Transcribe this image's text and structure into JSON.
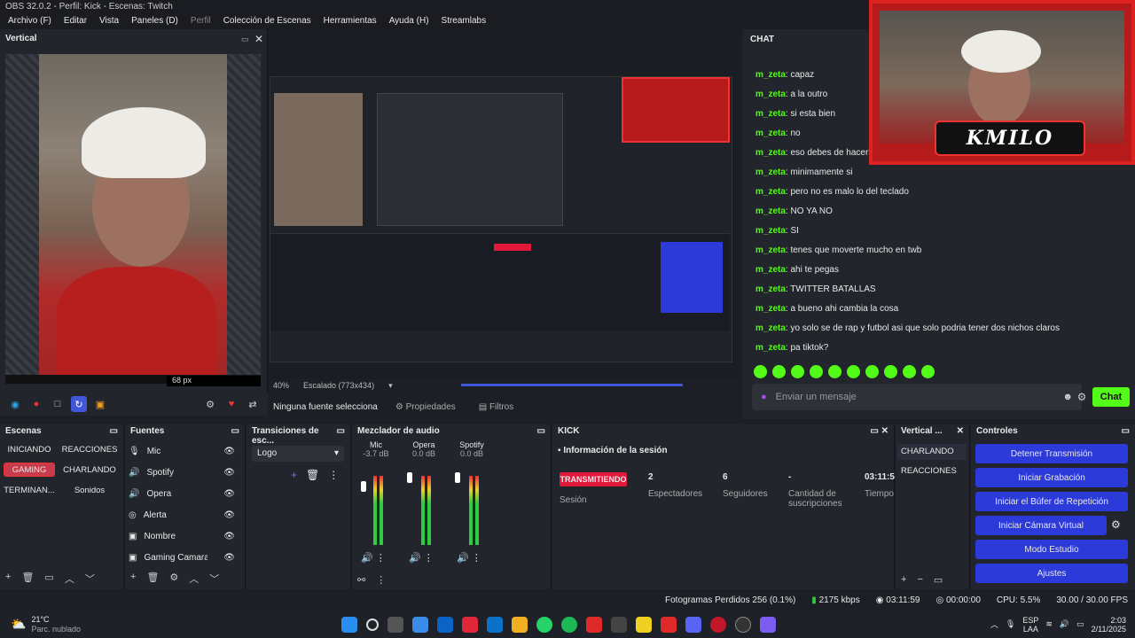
{
  "window": {
    "title": "OBS 32.0.2 - Perfil: Kick - Escenas: Twitch"
  },
  "menu": [
    "Archivo (F)",
    "Editar",
    "Vista",
    "Paneles (D)",
    "Perfil",
    "Colección de Escenas",
    "Herramientas",
    "Ayuda (H)",
    "Streamlabs"
  ],
  "vertical_dock": {
    "title": "Vertical",
    "px_label": "68 px"
  },
  "preview": {
    "zoom": "40%",
    "scaling": "Escalado (773x434)"
  },
  "props_bar": {
    "no_source": "Ninguna fuente selecciona",
    "properties": "Propiedades",
    "filters": "Filtros"
  },
  "chat": {
    "title": "CHAT",
    "messages": [
      {
        "user": "m_zeta",
        "text": "capaz"
      },
      {
        "user": "m_zeta",
        "text": "a la outro"
      },
      {
        "user": "m_zeta",
        "text": "si esta bien"
      },
      {
        "user": "m_zeta",
        "text": "no"
      },
      {
        "user": "m_zeta",
        "text": "eso debes de hacerlo offline"
      },
      {
        "user": "m_zeta",
        "text": "minimamente si"
      },
      {
        "user": "m_zeta",
        "text": "pero no es malo lo del teclado"
      },
      {
        "user": "m_zeta",
        "text": "NO YA NO"
      },
      {
        "user": "m_zeta",
        "text": "SI"
      },
      {
        "user": "m_zeta",
        "text": "tenes que moverte mucho en twb"
      },
      {
        "user": "m_zeta",
        "text": "ahi te pegas"
      },
      {
        "user": "m_zeta",
        "text": "TWITTER BATALLAS"
      },
      {
        "user": "m_zeta",
        "text": "a bueno ahi cambia la cosa"
      },
      {
        "user": "m_zeta",
        "text": "yo solo se de rap y futbol asi que solo podria tener dos nichos claros"
      },
      {
        "user": "m_zeta",
        "text": "pa tiktok?"
      }
    ],
    "input_placeholder": "Enviar un mensaje",
    "send_label": "Chat",
    "overlay_logo": "KMILO"
  },
  "scenes": {
    "title": "Escenas",
    "items": [
      "INICIANDO",
      "REACCIONES",
      "GAMING",
      "CHARLANDO",
      "TERMINAN...",
      "Sonidos"
    ]
  },
  "sources": {
    "title": "Fuentes",
    "items": [
      "Mic",
      "Spotify",
      "Opera",
      "Alerta",
      "Nombre",
      "Gaming Camara"
    ]
  },
  "transitions": {
    "title": "Transiciones de esc...",
    "selected": "Logo"
  },
  "mixer": {
    "title": "Mezclador de audio",
    "channels": [
      {
        "name": "Mic",
        "db": "-3.7 dB"
      },
      {
        "name": "Opera",
        "db": "0.0 dB"
      },
      {
        "name": "Spotify",
        "db": "0.0 dB"
      }
    ],
    "scale": [
      "0",
      "-5",
      "-10",
      "-15",
      "-20",
      "-25",
      "-30",
      "-35",
      "-40",
      "-45",
      "-50",
      "-55",
      "-60"
    ]
  },
  "kick": {
    "title": "KICK",
    "section": "Información de la sesión",
    "status_badge": "TRANSMITIENDO",
    "session_label": "Sesión",
    "stats": [
      {
        "value": "2",
        "label": "Espectadores"
      },
      {
        "value": "6",
        "label": "Seguidores"
      },
      {
        "value": "-",
        "label": "Cantidad de suscripciones"
      },
      {
        "value": "03:11:5",
        "label": "Tiempo en vivo"
      }
    ]
  },
  "vertical_scenes": {
    "title": "Vertical ...",
    "items": [
      "CHARLANDO",
      "REACCIONES"
    ]
  },
  "controls": {
    "title": "Controles",
    "buttons": [
      "Detener Transmisión",
      "Iniciar Grabación",
      "Iniciar el Búfer de Repetición",
      "Iniciar Cámara Virtual",
      "Modo Estudio",
      "Ajustes"
    ]
  },
  "status": {
    "dropped": "Fotogramas Perdidos 256 (0.1%)",
    "bitrate": "2175 kbps",
    "stream_time": "03:11:59",
    "rec_time": "00:00:00",
    "cpu": "CPU: 5.5%",
    "fps": "30.00 / 30.00 FPS"
  },
  "taskbar": {
    "weather_temp": "21°C",
    "weather_desc": "Parc. nublado",
    "lang": "ESP",
    "lang2": "LAA",
    "time": "2:03",
    "date": "2/11/2025"
  },
  "colors": {
    "accent": "#53fc18",
    "live": "#e0183a",
    "ctrl_primary": "#2b3ad8"
  }
}
